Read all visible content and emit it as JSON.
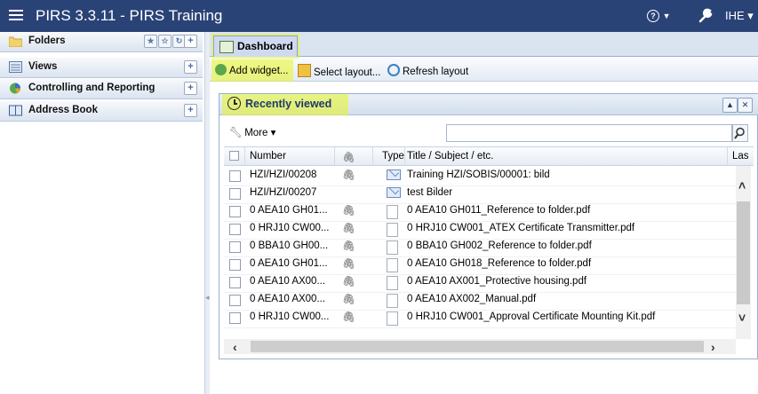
{
  "topbar": {
    "title": "PIRS 3.3.11  -  PIRS Training",
    "help_label": "⓪ ▾",
    "user_label": "IHE ▾",
    "bg_color": "#2a4377"
  },
  "sidebar": {
    "items": [
      {
        "label": "Folders",
        "icon": "folder-icon"
      },
      {
        "label": "Views",
        "icon": "views-icon"
      },
      {
        "label": "Controlling and Reporting",
        "icon": "chart-icon"
      },
      {
        "label": "Address Book",
        "icon": "address-book-icon"
      }
    ],
    "plus_label": "+"
  },
  "tabs": [
    {
      "label": "Dashboard",
      "icon": "dashboard-icon"
    }
  ],
  "toolbar": {
    "add_widget": "Add widget...",
    "select_layout": "Select layout...",
    "refresh_layout": "Refresh layout"
  },
  "widget": {
    "title": "Recently viewed",
    "more_label": "More ▾",
    "search_placeholder": "",
    "columns": {
      "number": "Number",
      "type": "Type",
      "title": "Title / Subject / etc.",
      "last": "Las"
    },
    "rows": [
      {
        "number": "HZI/HZI/00208",
        "attach": true,
        "type": "mail",
        "title": "Training HZI/SOBIS/00001: bild"
      },
      {
        "number": "HZI/HZI/00207",
        "attach": false,
        "type": "mail",
        "title": "test Bilder"
      },
      {
        "number": "0 AEA10 GH01...",
        "attach": true,
        "type": "doc",
        "title": "0 AEA10 GH011_Reference to folder.pdf"
      },
      {
        "number": "0 HRJ10 CW00...",
        "attach": true,
        "type": "doc",
        "title": "0 HRJ10 CW001_ATEX Certificate Transmitter.pdf"
      },
      {
        "number": "0 BBA10 GH00...",
        "attach": true,
        "type": "doc",
        "title": "0 BBA10 GH002_Reference to folder.pdf"
      },
      {
        "number": "0 AEA10 GH01...",
        "attach": true,
        "type": "doc",
        "title": "0 AEA10 GH018_Reference to folder.pdf"
      },
      {
        "number": "0 AEA10 AX00...",
        "attach": true,
        "type": "doc",
        "title": "0 AEA10 AX001_Protective housing.pdf"
      },
      {
        "number": "0 AEA10 AX00...",
        "attach": true,
        "type": "doc",
        "title": "0 AEA10 AX002_Manual.pdf"
      },
      {
        "number": "0 HRJ10 CW00...",
        "attach": true,
        "type": "doc",
        "title": "0 HRJ10 CW001_Approval Certificate Mounting Kit.pdf"
      }
    ]
  },
  "highlight_color": "#e8f51e"
}
